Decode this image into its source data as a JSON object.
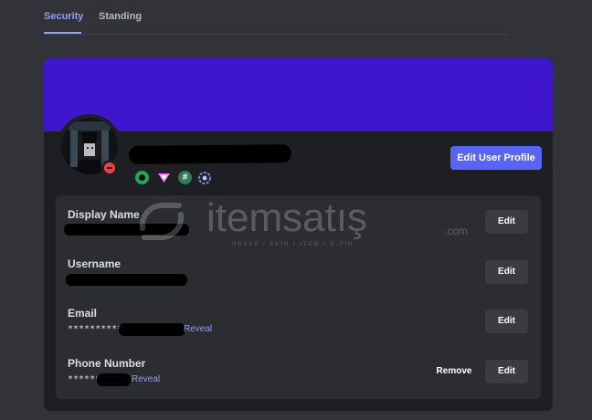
{
  "tabs": [
    {
      "label": "Security",
      "active": true
    },
    {
      "label": "Standing",
      "active": false
    }
  ],
  "profile": {
    "edit_button_label": "Edit User Profile",
    "status": "do-not-disturb",
    "badges": [
      "quest-badge-icon",
      "nitro-badge-icon",
      "hypesquad-badge-icon",
      "boost-badge-icon"
    ]
  },
  "fields": {
    "display_name": {
      "label": "Display Name",
      "edit_label": "Edit"
    },
    "username": {
      "label": "Username",
      "edit_label": "Edit"
    },
    "email": {
      "label": "Email",
      "masked_prefix": "***********",
      "reveal_label": "Reveal",
      "edit_label": "Edit"
    },
    "phone": {
      "label": "Phone Number",
      "masked_prefix": "*******",
      "reveal_label": "Reveal",
      "remove_label": "Remove",
      "edit_label": "Edit"
    }
  },
  "watermark": {
    "brand": "itemsatış",
    "tagline": "HESAP / SKIN / ITEM / E-PIN",
    "suffix": ".com"
  },
  "colors": {
    "background": "#313338",
    "card": "#1e1f22",
    "banner": "#3f16cc",
    "accent": "#5865f2",
    "link": "#949cf7",
    "dnd": "#f23f43"
  }
}
